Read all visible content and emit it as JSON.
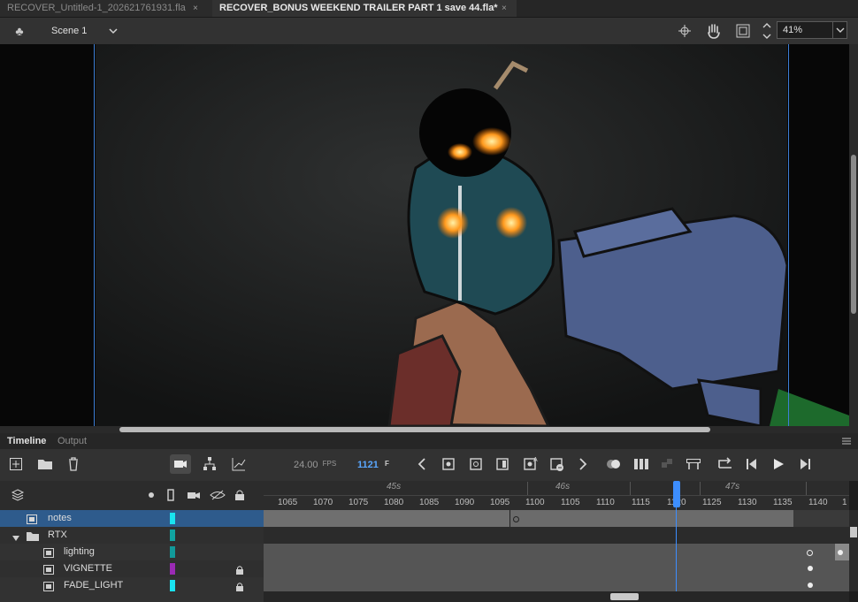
{
  "doc_tabs": [
    {
      "title": "RECOVER_Untitled-1_202621761931.fla",
      "close": "×",
      "active": false
    },
    {
      "title": "RECOVER_BONUS WEEKEND TRAILER PART 1 save 44.fla*",
      "close": "×",
      "active": true
    }
  ],
  "edit_bar": {
    "scene_icon": "scene-clubs-icon",
    "scene_label": "Scene 1",
    "scene_dropdown": "chevron-down-icon",
    "tools": [
      "snap-crosshair-icon",
      "hand-icon",
      "clip-stage-icon",
      "stepper-icon"
    ],
    "zoom_value": "41%"
  },
  "panel_tabs": {
    "timeline": "Timeline",
    "output": "Output"
  },
  "timeline_toolbar": {
    "fps_value": "24.00",
    "fps_unit": "FPS",
    "current_frame": "1121",
    "frame_unit": "F"
  },
  "ruler": {
    "frame_ticks": [
      "1065",
      "1070",
      "1075",
      "1080",
      "1085",
      "1090",
      "1095",
      "1100",
      "1105",
      "1110",
      "1115",
      "1120",
      "1125",
      "1130",
      "1135",
      "1140",
      "1"
    ],
    "seconds": [
      "45s",
      "46s",
      "47s"
    ]
  },
  "layers": [
    {
      "name": "notes",
      "type": "layer",
      "color": "#19e3f0",
      "locked": false,
      "selected": true,
      "indent": 0
    },
    {
      "name": "RTX",
      "type": "folder",
      "color": "#11a3a0",
      "locked": false,
      "selected": false,
      "indent": 0
    },
    {
      "name": "lighting",
      "type": "layer",
      "color": "#119a9a",
      "locked": false,
      "selected": false,
      "indent": 1
    },
    {
      "name": "VIGNETTE",
      "type": "layer",
      "color": "#9a2ab4",
      "locked": true,
      "selected": false,
      "indent": 1
    },
    {
      "name": "FADE_LIGHT",
      "type": "layer",
      "color": "#19e3f0",
      "locked": true,
      "selected": false,
      "indent": 1
    }
  ],
  "colors": {
    "accent": "#3d8eff",
    "selected_row": "#2e5b8c"
  }
}
